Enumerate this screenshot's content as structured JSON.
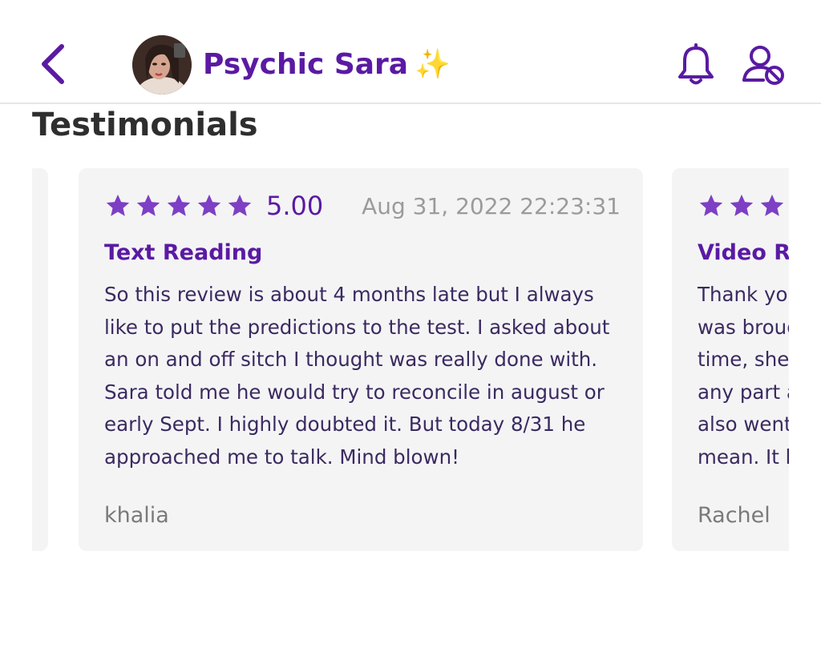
{
  "header": {
    "title": "Psychic Sara",
    "title_emoji": "✨",
    "accent_color": "#5a1aa3",
    "icons": [
      "chevron-left-icon",
      "bell-icon",
      "user-block-icon"
    ]
  },
  "section": {
    "title": "Testimonials"
  },
  "reviews": [
    {
      "stars": 5,
      "rating": "5.00",
      "date": "Aug 31, 2022 22:23:31",
      "type": "Text Reading",
      "text": "So this review is about 4 months late but I always like to put the predictions to the test. I asked about an on and off sitch I thought was really done with. Sara told me he would try to reconcile in august or early Sept. I highly doubted it. But today 8/31 he approached me to talk. Mind blown!",
      "author": "khalia"
    },
    {
      "type": "Video Re",
      "lines": [
        "Thank you",
        "was broug",
        "time, she",
        "any part a",
        "also went",
        "mean. It h"
      ],
      "author": "Rachel"
    }
  ]
}
